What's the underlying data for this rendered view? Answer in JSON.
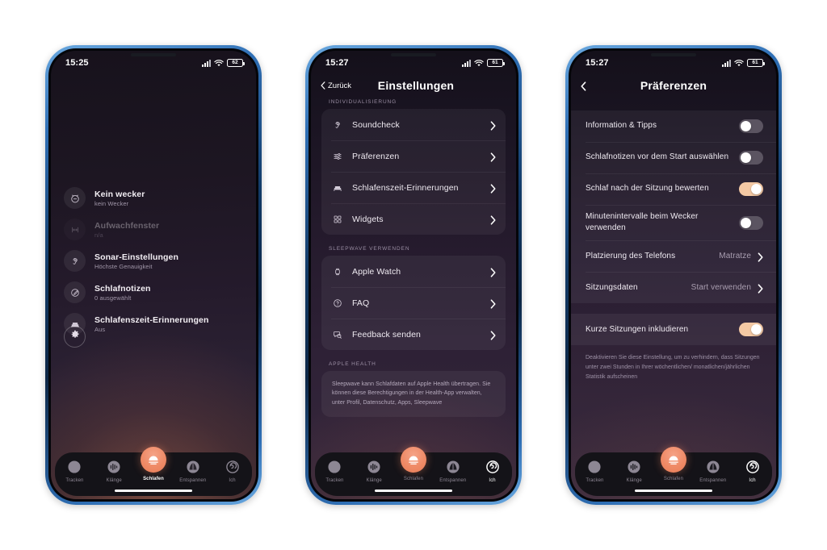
{
  "page": {
    "background": "#ffffff"
  },
  "phones": [
    {
      "id": "phone-home",
      "status": {
        "time": "15:25",
        "battery": "62"
      },
      "list": [
        {
          "icon": "alarm-off-icon",
          "title": "Kein wecker",
          "subtitle": "kein Wecker",
          "dimmed": false
        },
        {
          "icon": "wake-window-icon",
          "title": "Aufwachfenster",
          "subtitle": "n/a",
          "dimmed": true
        },
        {
          "icon": "sonar-ear-icon",
          "title": "Sonar-Einstellungen",
          "subtitle": "Höchste Genauigkeit",
          "dimmed": false
        },
        {
          "icon": "pencil-circle-icon",
          "title": "Schlafnotizen",
          "subtitle": "0 ausgewählt",
          "dimmed": false
        },
        {
          "icon": "bed-icon",
          "title": "Schlafenszeit-Erinnerungen",
          "subtitle": "Aus",
          "dimmed": false
        }
      ],
      "settings_button": "gear-icon",
      "tabs": [
        {
          "label": "Tracken",
          "icon": "moon-icon",
          "state": "inactive"
        },
        {
          "label": "Klänge",
          "icon": "sound-bars-icon",
          "state": "inactive"
        },
        {
          "label": "Schlafen",
          "icon": "sunset-icon",
          "state": "active"
        },
        {
          "label": "Entspannen",
          "icon": "leaf-fan-icon",
          "state": "inactive"
        },
        {
          "label": "Ich",
          "icon": "spiral-target-icon",
          "state": "inactive"
        }
      ]
    },
    {
      "id": "phone-settings",
      "status": {
        "time": "15:27",
        "battery": "61"
      },
      "nav": {
        "back_label": "Zurück",
        "title": "Einstellungen"
      },
      "sections": [
        {
          "header": "INDIVIDUALISIERUNG",
          "rows": [
            {
              "icon": "sonar-ear-icon",
              "label": "Soundcheck"
            },
            {
              "icon": "sliders-icon",
              "label": "Präferenzen"
            },
            {
              "icon": "bed-icon",
              "label": "Schlafenszeit-Erinnerungen"
            },
            {
              "icon": "widgets-grid-icon",
              "label": "Widgets"
            }
          ]
        },
        {
          "header": "SLEEPWAVE VERWENDEN",
          "rows": [
            {
              "icon": "watch-icon",
              "label": "Apple Watch"
            },
            {
              "icon": "question-circle-icon",
              "label": "FAQ"
            },
            {
              "icon": "chat-bubble-icon",
              "label": "Feedback senden"
            }
          ]
        },
        {
          "header": "APPLE HEALTH",
          "note": "Sleepwave kann Schlafdaten auf Apple Health übertragen. Sie können diese Berechtigungen in der Health-App verwalten, unter Profil, Datenschutz, Apps, Sleepwave"
        }
      ],
      "tabs": [
        {
          "label": "Tracken",
          "icon": "moon-icon",
          "state": "inactive"
        },
        {
          "label": "Klänge",
          "icon": "sound-bars-icon",
          "state": "inactive"
        },
        {
          "label": "Schlafen",
          "icon": "sunset-icon",
          "state": "inactive"
        },
        {
          "label": "Entspannen",
          "icon": "leaf-fan-icon",
          "state": "inactive"
        },
        {
          "label": "Ich",
          "icon": "spiral-target-icon",
          "state": "selected"
        }
      ]
    },
    {
      "id": "phone-prefs",
      "status": {
        "time": "15:27",
        "battery": "61"
      },
      "nav": {
        "back_label": "",
        "title": "Präferenzen"
      },
      "rows": [
        {
          "type": "toggle",
          "label": "Information & Tipps",
          "value": "off"
        },
        {
          "type": "toggle",
          "label": "Schlafnotizen vor dem Start auswählen",
          "value": "off"
        },
        {
          "type": "toggle",
          "label": "Schlaf nach der Sitzung bewerten",
          "value": "on"
        },
        {
          "type": "toggle",
          "label": "Minutenintervalle beim Wecker verwenden",
          "value": "off"
        },
        {
          "type": "value",
          "label": "Platzierung des Telefons",
          "value": "Matratze"
        },
        {
          "type": "value",
          "label": "Sitzungsdaten",
          "value": "Start verwenden"
        }
      ],
      "short_sessions": {
        "label": "Kurze Sitzungen inkludieren",
        "value": "on"
      },
      "note": "Deaktivieren Sie diese Einstellung, um zu verhindern, dass Sitzungen unter zwei Stunden in Ihrer wöchentlichen/ monatlichen/jährlichen Statistik aufscheinen",
      "tabs": [
        {
          "label": "Tracken",
          "icon": "moon-icon",
          "state": "inactive"
        },
        {
          "label": "Klänge",
          "icon": "sound-bars-icon",
          "state": "inactive"
        },
        {
          "label": "Schlafen",
          "icon": "sunset-icon",
          "state": "inactive"
        },
        {
          "label": "Entspannen",
          "icon": "leaf-fan-icon",
          "state": "inactive"
        },
        {
          "label": "Ich",
          "icon": "spiral-target-icon",
          "state": "selected"
        }
      ]
    }
  ],
  "colors": {
    "accent": "#ef8a66",
    "toggle_on": "#f4c9a4",
    "toggle_off": "#5b5461",
    "frame": "#2f6fb5"
  }
}
